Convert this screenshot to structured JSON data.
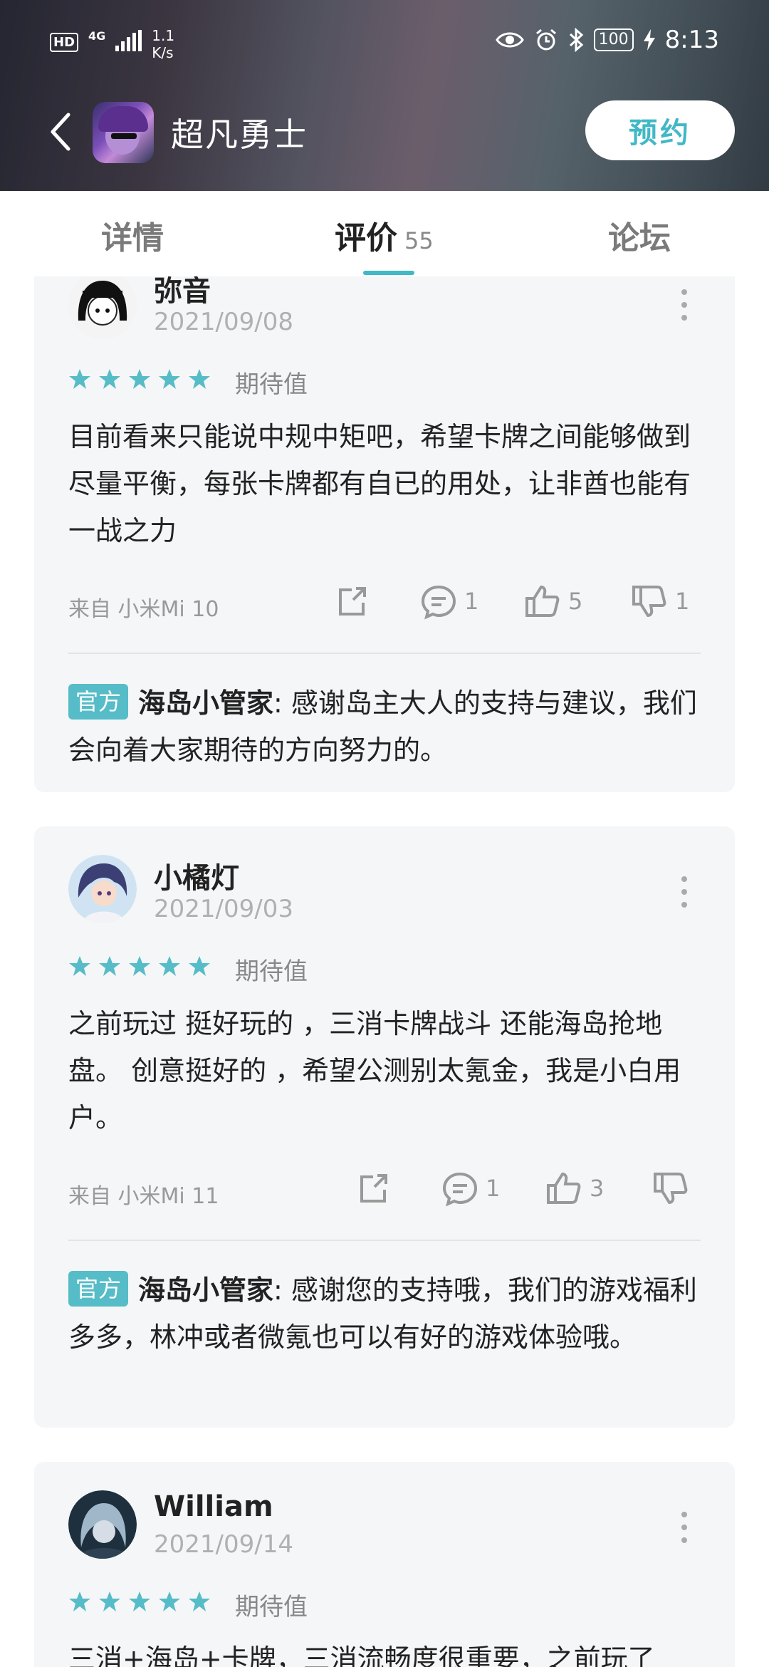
{
  "status_bar": {
    "hd": "HD",
    "network": "4G",
    "speed_value": "1.1",
    "speed_unit": "K/s",
    "battery": "100",
    "time": "8:13"
  },
  "header": {
    "game_title": "超凡勇士",
    "reserve_label": "预约"
  },
  "tabs": {
    "detail": "详情",
    "reviews": "评价",
    "reviews_count": "55",
    "forum": "论坛"
  },
  "colors": {
    "accent": "#41b8c6",
    "star": "#56bcc7",
    "card_bg": "#f5f6f8"
  },
  "reviews": [
    {
      "user": "弥音",
      "date": "2021/09/08",
      "stars": 5,
      "rating_label": "期待值",
      "text": "目前看来只能说中规中矩吧，希望卡牌之间能够做到尽量平衡，每张卡牌都有自已的用处，让非酋也能有一战之力",
      "device": "来自 小米Mi 10",
      "comments": "1",
      "likes": "5",
      "dislikes": "1",
      "reply_tag": "官方",
      "reply_author": "海岛小管家",
      "reply_text": ": 感谢岛主大人的支持与建议，我们会向着大家期待的方向努力的。"
    },
    {
      "user": "小橘灯",
      "date": "2021/09/03",
      "stars": 5,
      "rating_label": "期待值",
      "text": "之前玩过 挺好玩的 ，三消卡牌战斗 还能海岛抢地盘。 创意挺好的 ，希望公测别太氪金，我是小白用户。",
      "device": "来自 小米Mi 11",
      "comments": "1",
      "likes": "3",
      "dislikes": "",
      "reply_tag": "官方",
      "reply_author": "海岛小管家",
      "reply_text": ": 感谢您的支持哦，我们的游戏福利多多，林冲或者微氪也可以有好的游戏体验哦。"
    },
    {
      "user": "William",
      "date": "2021/09/14",
      "stars": 5,
      "rating_label": "期待值",
      "text": "三消+海岛+卡牌，三消流畅度很重要，之前玩了"
    }
  ]
}
